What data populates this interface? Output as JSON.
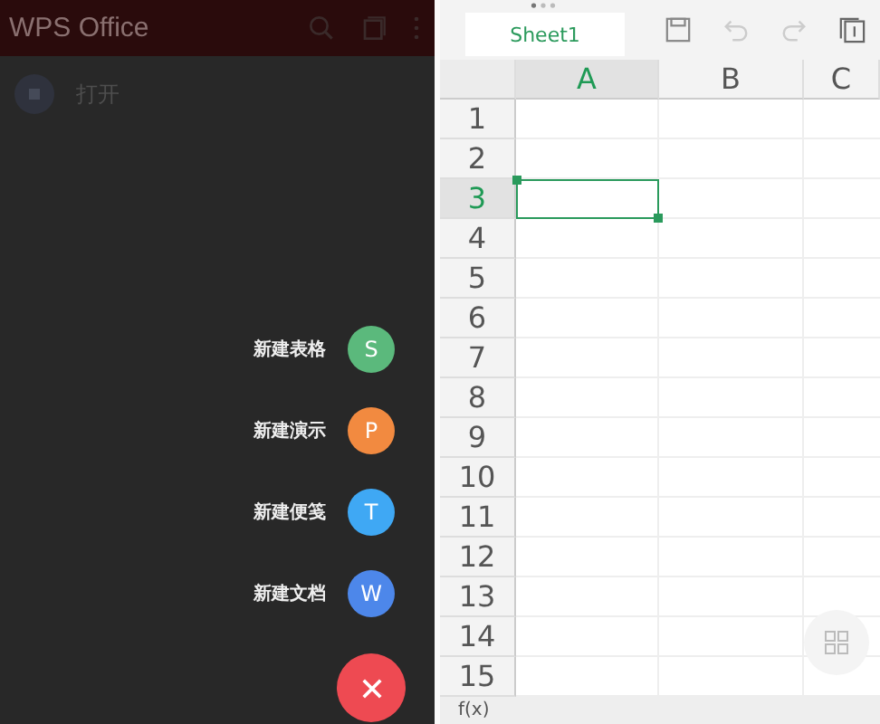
{
  "left": {
    "app_bar": {
      "title": "WPS Office"
    },
    "list": [
      {
        "label": "打开"
      }
    ],
    "fab_menu": [
      {
        "label": "新建表格",
        "letter": "S",
        "color": "#5bb97c"
      },
      {
        "label": "新建演示",
        "letter": "P",
        "color": "#f28a40"
      },
      {
        "label": "新建便笺",
        "letter": "T",
        "color": "#3fa8f4"
      },
      {
        "label": "新建文档",
        "letter": "W",
        "color": "#4d87ea"
      }
    ]
  },
  "right": {
    "sheet_tabs": [
      {
        "label": "Sheet1",
        "selected": true
      }
    ],
    "columns": [
      {
        "label": "A",
        "selected": true
      },
      {
        "label": "B",
        "selected": false
      },
      {
        "label": "C",
        "selected": false
      }
    ],
    "rows": [
      {
        "label": "1",
        "selected": false
      },
      {
        "label": "2",
        "selected": false
      },
      {
        "label": "3",
        "selected": true
      },
      {
        "label": "4",
        "selected": false
      },
      {
        "label": "5",
        "selected": false
      },
      {
        "label": "6",
        "selected": false
      },
      {
        "label": "7",
        "selected": false
      },
      {
        "label": "8",
        "selected": false
      },
      {
        "label": "9",
        "selected": false
      },
      {
        "label": "10",
        "selected": false
      },
      {
        "label": "11",
        "selected": false
      },
      {
        "label": "12",
        "selected": false
      },
      {
        "label": "13",
        "selected": false
      },
      {
        "label": "14",
        "selected": false
      },
      {
        "label": "15",
        "selected": false
      }
    ],
    "formula_bar": {
      "label": "f(x)"
    }
  }
}
